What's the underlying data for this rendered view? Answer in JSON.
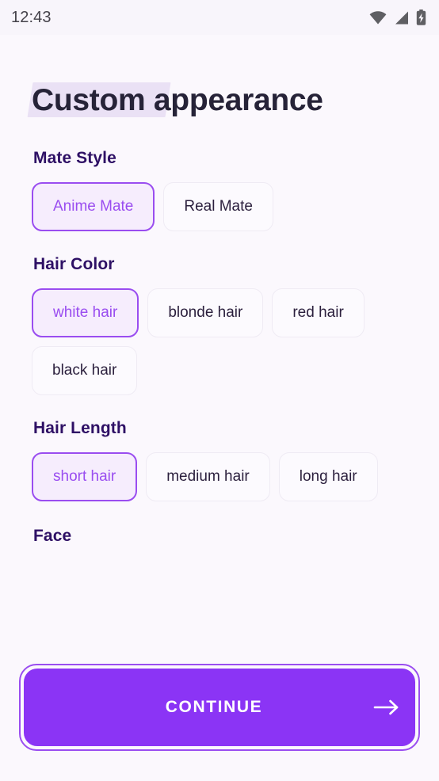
{
  "status_bar": {
    "time": "12:43",
    "icons": [
      "wifi-icon",
      "cellular-signal-icon",
      "battery-charging-icon"
    ]
  },
  "header": {
    "title": "Custom appearance",
    "highlight_word": "Custom",
    "highlight_color": "#EAE1F5",
    "title_color": "#262338"
  },
  "theme": {
    "background": "#FBF8FD",
    "accent": "#9A4DF0",
    "button_fill": "#8B34F5",
    "selected_chip_fill": "#F6EDFD",
    "chip_fill": "#FCFAFE",
    "heading_color": "#2E1065"
  },
  "sections": [
    {
      "title": "Mate Style",
      "options": [
        {
          "label": "Anime Mate",
          "selected": true
        },
        {
          "label": "Real Mate",
          "selected": false
        }
      ]
    },
    {
      "title": "Hair Color",
      "options": [
        {
          "label": "white hair",
          "selected": true
        },
        {
          "label": "blonde hair",
          "selected": false
        },
        {
          "label": "red hair",
          "selected": false
        },
        {
          "label": "black hair",
          "selected": false
        }
      ]
    },
    {
      "title": "Hair Length",
      "options": [
        {
          "label": "short hair",
          "selected": true
        },
        {
          "label": "medium hair",
          "selected": false
        },
        {
          "label": "long hair",
          "selected": false
        }
      ]
    },
    {
      "title": "Face",
      "options": []
    }
  ],
  "cta": {
    "label": "CONTINUE",
    "icon": "arrow-right-icon",
    "focused": true
  }
}
